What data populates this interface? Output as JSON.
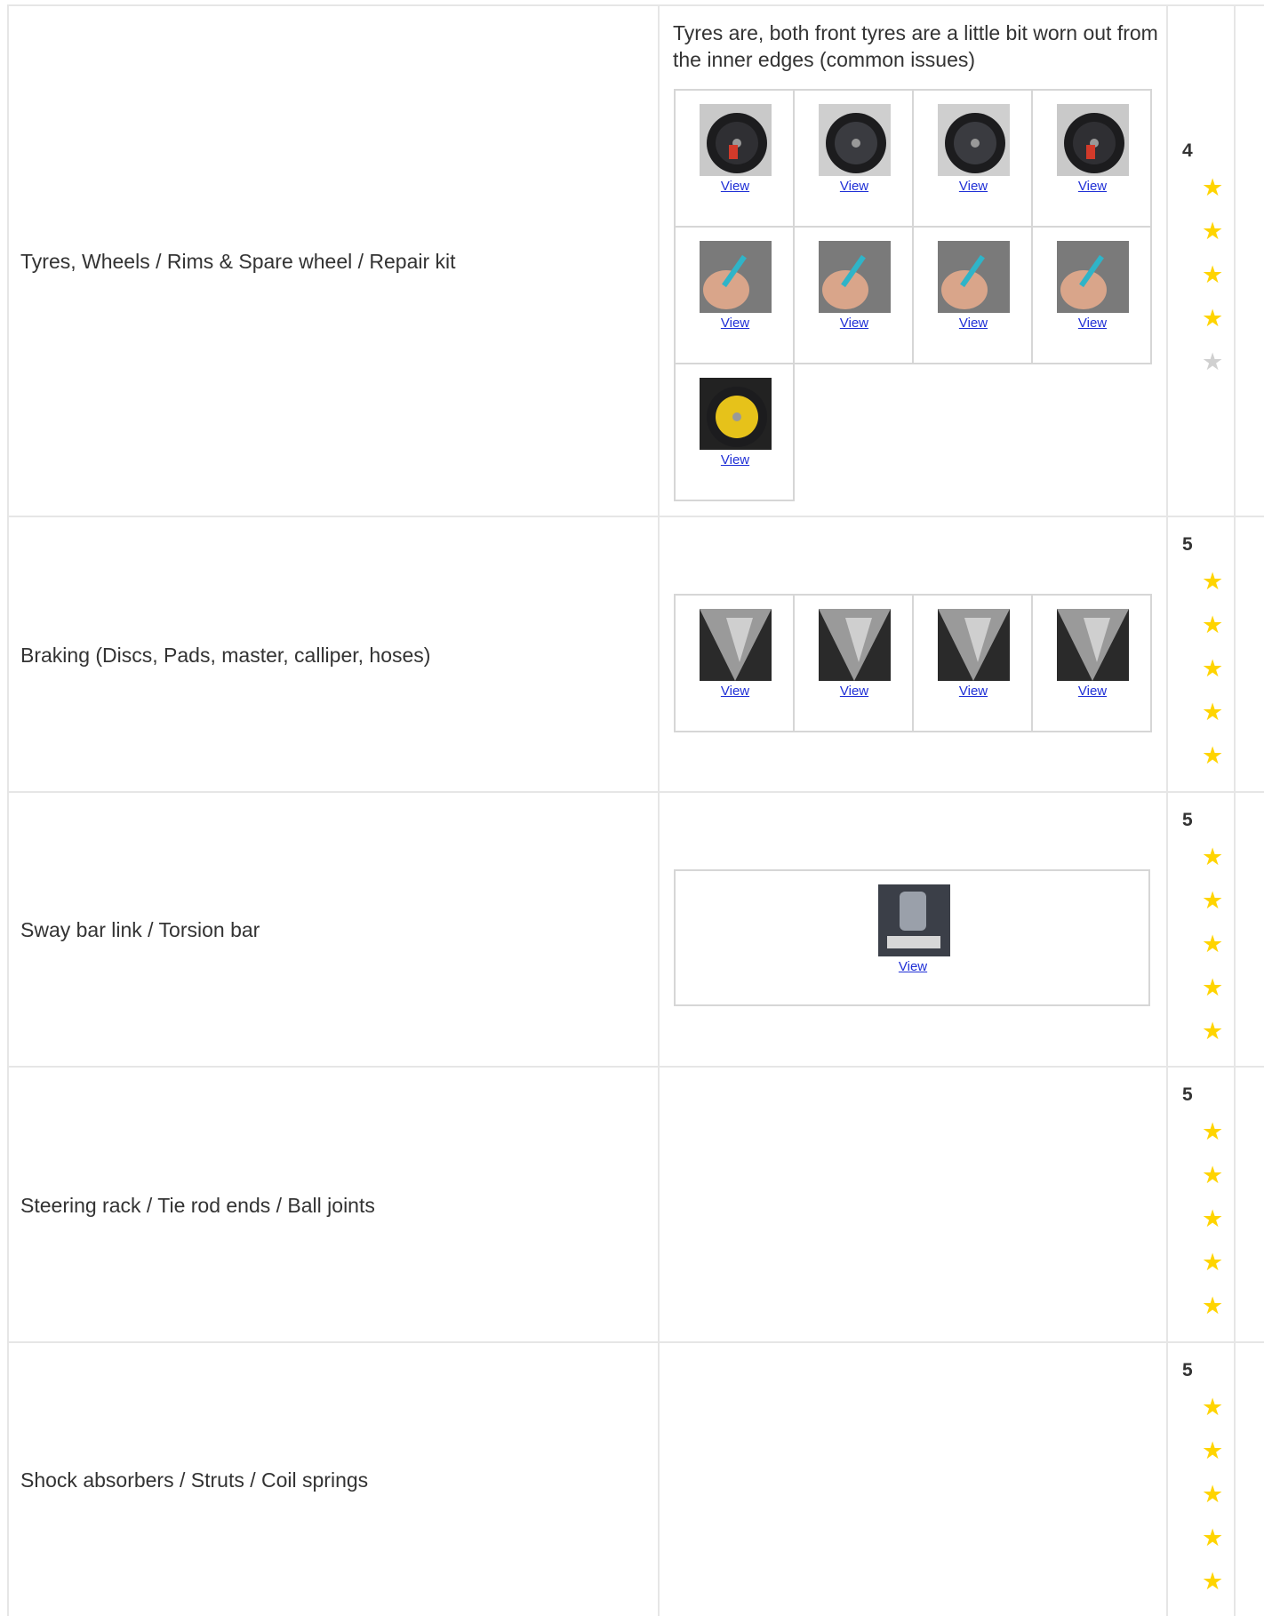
{
  "colors": {
    "link": "#1f2fd6",
    "star_on": "#ffd400",
    "star_off": "#d0d0d0",
    "grid": "#e6e6e6"
  },
  "rows": [
    {
      "label": "Tyres, Wheels / Rims & Spare wheel / Repair kit",
      "note": "Tyres are, both front tyres are a little bit worn out from the inner edges (common issues)",
      "rating": "4",
      "stars_filled": 4,
      "stars_total": 5,
      "photos": [
        {
          "link": "View",
          "subject": "wheel with red caliper"
        },
        {
          "link": "View",
          "subject": "alloy wheel"
        },
        {
          "link": "View",
          "subject": "alloy wheel"
        },
        {
          "link": "View",
          "subject": "wheel with red caliper"
        },
        {
          "link": "View",
          "subject": "tread depth gauge"
        },
        {
          "link": "View",
          "subject": "tread depth gauge"
        },
        {
          "link": "View",
          "subject": "tread depth gauge"
        },
        {
          "link": "View",
          "subject": "tread depth gauge"
        },
        {
          "link": "View",
          "subject": "spare wheel well"
        }
      ]
    },
    {
      "label": "Braking (Discs, Pads, master, calliper, hoses)",
      "note": "",
      "rating": "5",
      "stars_filled": 5,
      "stars_total": 5,
      "photos": [
        {
          "link": "View",
          "subject": "brake disc"
        },
        {
          "link": "View",
          "subject": "brake disc"
        },
        {
          "link": "View",
          "subject": "brake disc"
        },
        {
          "link": "View",
          "subject": "brake disc"
        }
      ]
    },
    {
      "label": "Sway bar link / Torsion bar",
      "note": "",
      "rating": "5",
      "stars_filled": 5,
      "stars_total": 5,
      "photos": [
        {
          "link": "View",
          "subject": "suspension link"
        }
      ]
    },
    {
      "label": "Steering rack / Tie rod ends / Ball joints",
      "note": "",
      "rating": "5",
      "stars_filled": 5,
      "stars_total": 5,
      "photos": []
    },
    {
      "label": "Shock absorbers / Struts / Coil springs",
      "note": "",
      "rating": "5",
      "stars_filled": 5,
      "stars_total": 5,
      "photos": []
    }
  ]
}
